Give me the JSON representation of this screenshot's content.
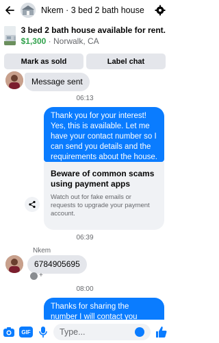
{
  "header": {
    "title": "Nkem · 3 bed 2 bath house"
  },
  "listing": {
    "title": "3 bed 2 bath house available for rent.",
    "price": "$1,300",
    "location": " · Norwalk, CA"
  },
  "actions": {
    "mark_sold": "Mark as sold",
    "label_chat": "Label chat"
  },
  "thread": {
    "msg_sent": "Message sent",
    "time1": "06:13",
    "out1": "Thank you for your interest! Yes, this is available. Let me have your contact number so I can send you details and the requirements about the house.",
    "card_title": "Beware of common scams using payment apps",
    "card_sub": "Watch out for fake emails or requests to upgrade your payment account.",
    "time2": "06:39",
    "sender_name": "Nkem",
    "in_phone": "6784905695",
    "time3": "08:00",
    "out2": "Thanks for sharing the number I will contact you soon."
  },
  "composer": {
    "gif_label": "GIF",
    "placeholder": "Type..."
  },
  "colors": {
    "accent": "#0a7cff",
    "price_green": "#31a24c",
    "bubble_grey": "#e4e6eb"
  },
  "icons": [
    "back-arrow-icon",
    "gear-icon",
    "share-icon",
    "camera-icon",
    "gif-icon",
    "microphone-icon",
    "emoji-icon",
    "thumbs-up-icon"
  ]
}
